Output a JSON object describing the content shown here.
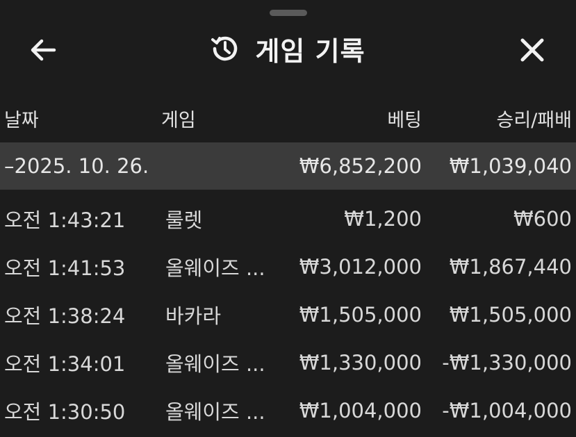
{
  "header": {
    "title": "게임 기록"
  },
  "columns": {
    "date": "날짜",
    "game": "게임",
    "bet": "베팅",
    "result": "승리/패배"
  },
  "summary": {
    "date": "–2025. 10. 26.",
    "bet": "₩6,852,200",
    "result": "₩1,039,040"
  },
  "rows": [
    {
      "time": "오전 1:43:21",
      "game": "룰렛",
      "bet": "₩1,200",
      "result": "₩600"
    },
    {
      "time": "오전 1:41:53",
      "game": "올웨이즈 ...",
      "bet": "₩3,012,000",
      "result": "₩1,867,440"
    },
    {
      "time": "오전 1:38:24",
      "game": "바카라",
      "bet": "₩1,505,000",
      "result": "₩1,505,000"
    },
    {
      "time": "오전 1:34:01",
      "game": "올웨이즈 ...",
      "bet": "₩1,330,000",
      "result": "-₩1,330,000"
    },
    {
      "time": "오전 1:30:50",
      "game": "올웨이즈 ...",
      "bet": "₩1,004,000",
      "result": "-₩1,004,000"
    }
  ],
  "colors": {
    "background": "#1c1c1c",
    "summary_row": "#3b3b3b",
    "text": "#e6e6e6"
  }
}
